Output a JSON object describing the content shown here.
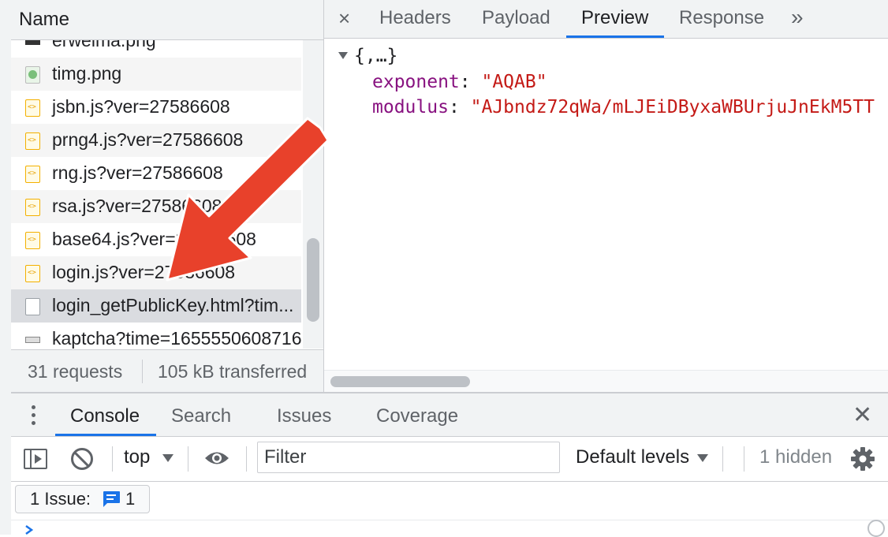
{
  "network": {
    "name_header": "Name",
    "requests": [
      {
        "label": "erweima.png",
        "icon": "image-icon"
      },
      {
        "label": "timg.png",
        "icon": "image-icon"
      },
      {
        "label": "jsbn.js?ver=27586608",
        "icon": "script-icon"
      },
      {
        "label": "prng4.js?ver=27586608",
        "icon": "script-icon"
      },
      {
        "label": "rng.js?ver=27586608",
        "icon": "script-icon"
      },
      {
        "label": "rsa.js?ver=27586608",
        "icon": "script-icon"
      },
      {
        "label": "base64.js?ver=27586608",
        "icon": "script-icon"
      },
      {
        "label": "login.js?ver=27586608",
        "icon": "script-icon"
      },
      {
        "label": "login_getPublicKey.html?tim...",
        "icon": "document-icon"
      },
      {
        "label": "kaptcha?time=1655550608716",
        "icon": "image-icon"
      }
    ],
    "status": {
      "requests": "31 requests",
      "transferred": "105 kB transferred"
    }
  },
  "details": {
    "close_symbol": "×",
    "tabs": [
      "Headers",
      "Payload",
      "Preview",
      "Response"
    ],
    "active_tab": "Preview",
    "more_symbol": "»",
    "preview": {
      "summary": "{,…}",
      "fields": [
        {
          "key": "exponent",
          "value": "\"AQAB\""
        },
        {
          "key": "modulus",
          "value": "\"AJbndz72qWa/mLJEiDByxaWBUrjuJnEkM5TT"
        }
      ]
    }
  },
  "drawer": {
    "tabs": [
      "Console",
      "Search",
      "Issues",
      "Coverage"
    ],
    "active_tab": "Console",
    "close_symbol": "✕",
    "toolbar": {
      "context": "top",
      "filter_placeholder": "Filter",
      "levels": "Default levels",
      "hidden": "1 hidden"
    },
    "issues": {
      "label": "1 Issue:",
      "count": "1"
    }
  },
  "colors": {
    "accent": "#1a73e8",
    "annotation_arrow": "#e8412b",
    "json_key": "#881280",
    "json_string": "#c41a16"
  }
}
